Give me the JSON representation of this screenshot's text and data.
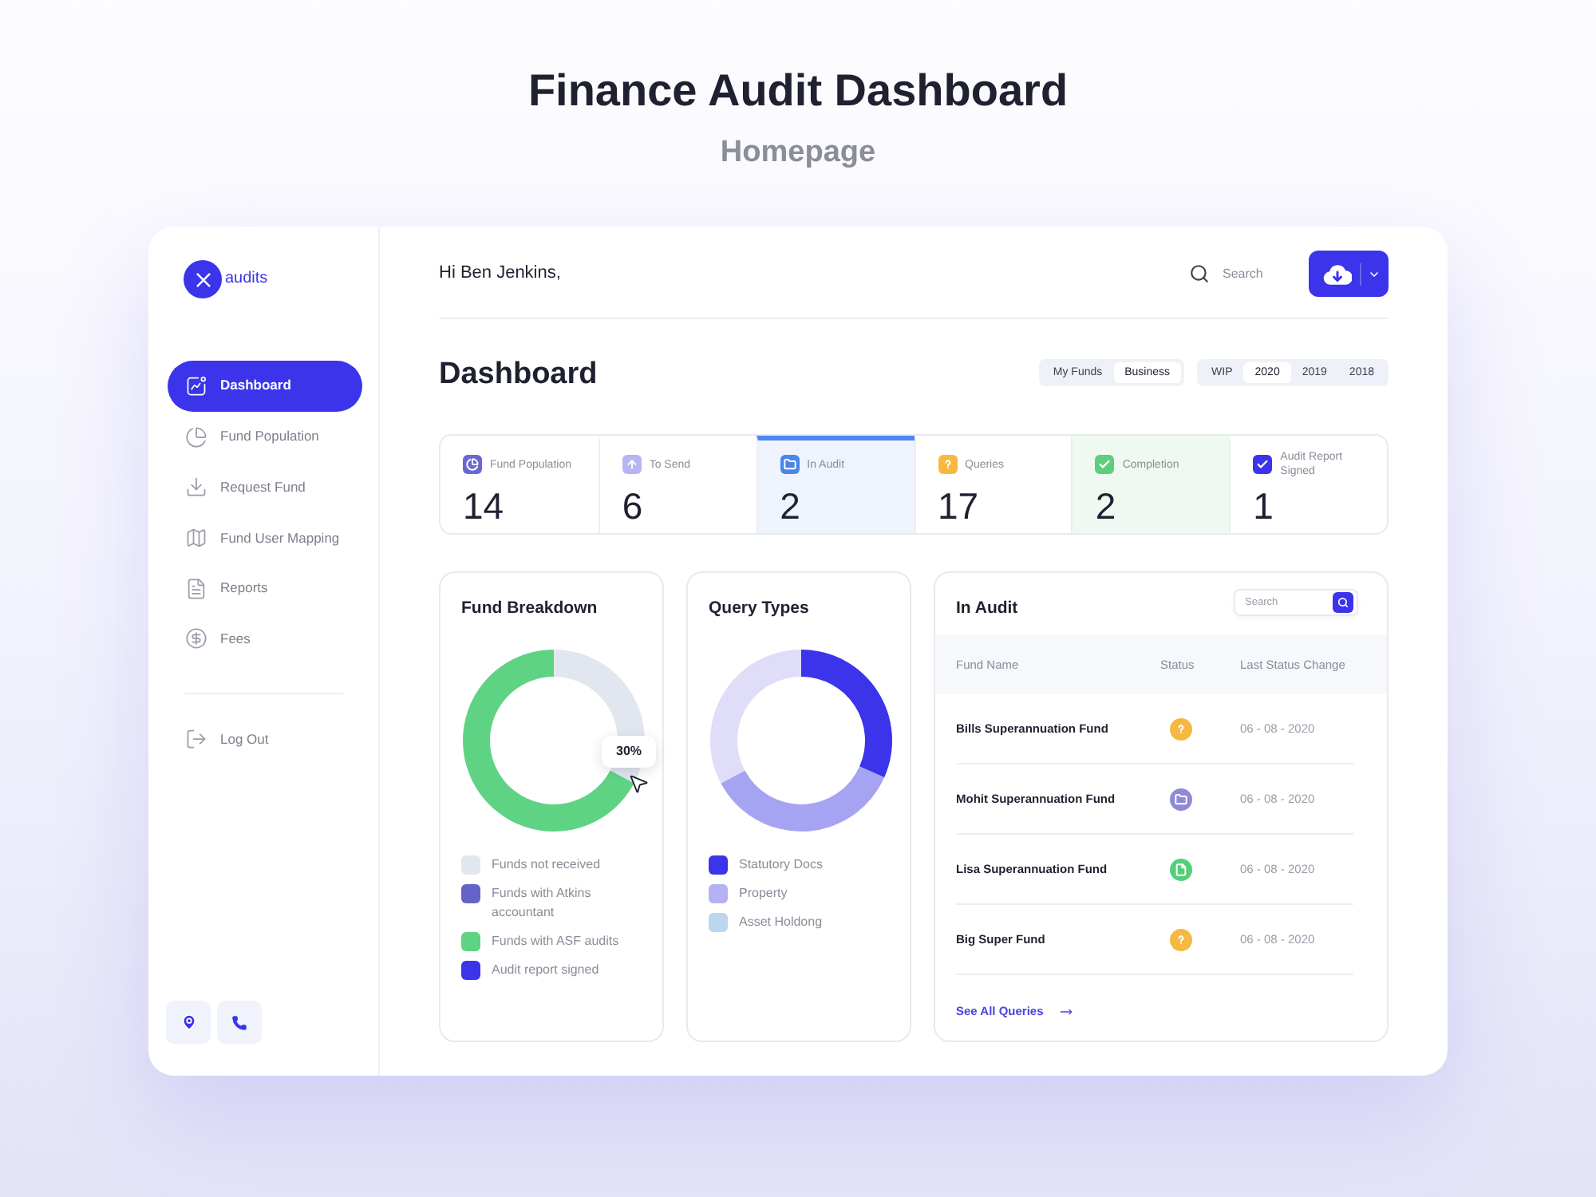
{
  "page": {
    "title": "Finance Audit Dashboard",
    "subtitle": "Homepage"
  },
  "sidebar": {
    "logo_text": "audits",
    "items": [
      {
        "label": "Dashboard",
        "selected": true
      },
      {
        "label": "Fund Population",
        "selected": false
      },
      {
        "label": "Request Fund",
        "selected": false
      },
      {
        "label": "Fund User Mapping",
        "selected": false
      },
      {
        "label": "Reports",
        "selected": false
      },
      {
        "label": "Fees",
        "selected": false
      }
    ],
    "logout": {
      "label": "Log Out"
    }
  },
  "header": {
    "greeting": "Hi Ben Jenkins,",
    "search": {
      "placeholder": "Search"
    }
  },
  "dashboard": {
    "title": "Dashboard",
    "tab_groups": [
      [
        {
          "label": "My Funds",
          "selected": false
        },
        {
          "label": "Business",
          "selected": true
        }
      ],
      [
        {
          "label": "WIP",
          "selected": false
        },
        {
          "label": "2020",
          "selected": true
        },
        {
          "label": "2019",
          "selected": false
        },
        {
          "label": "2018",
          "selected": false
        }
      ]
    ]
  },
  "stats": [
    {
      "label": "Fund Population",
      "value": "14",
      "color": "#6868d0",
      "selected": false
    },
    {
      "label": "To Send",
      "value": "6",
      "color": "#b7b5f2",
      "selected": false
    },
    {
      "label": "In Audit",
      "value": "2",
      "color": "#4a86e8",
      "selected": true,
      "highlight": {
        "color": "#eef3fd"
      }
    },
    {
      "label": "Queries",
      "value": "17",
      "color": "#f5b942",
      "selected": false
    },
    {
      "label": "Completion",
      "value": "2",
      "color": "#5ccf7d",
      "selected": false,
      "highlight": {
        "color": "#eff9f1"
      }
    },
    {
      "label": "Audit Report Signed",
      "value": "1",
      "color": "#3b34ea",
      "selected": false
    }
  ],
  "fund_breakdown": {
    "title": "Fund Breakdown",
    "tooltip": "30%",
    "legend": [
      {
        "label": "Funds not received",
        "color": "#e2e6ee"
      },
      {
        "label": "Funds with Atkins accountant",
        "color": "#6464c8"
      },
      {
        "label": "Funds with ASF audits",
        "color": "#5fd384"
      },
      {
        "label": "Audit report signed",
        "color": "#3b34ea"
      }
    ]
  },
  "query_types": {
    "title": "Query Types",
    "legend": [
      {
        "label": "Statutory Docs",
        "color": "#3b34ea"
      },
      {
        "label": "Property",
        "color": "#b4b2f2"
      },
      {
        "label": "Asset Holdong",
        "color": "#bcd6ee"
      }
    ]
  },
  "in_audit": {
    "title": "In Audit",
    "search": {
      "placeholder": "Search"
    },
    "columns": [
      "Fund Name",
      "Status",
      "Last Status Change"
    ],
    "rows": [
      {
        "fund_name": "Bills Superannuation Fund",
        "status": {
          "kind": "query",
          "color": "#f5b942"
        },
        "last_status_change": "06 - 08 - 2020"
      },
      {
        "fund_name": "Mohit Superannuation Fund",
        "status": {
          "kind": "folder",
          "color": "#8f8ad8"
        },
        "last_status_change": "06 - 08 - 2020"
      },
      {
        "fund_name": "Lisa Superannuation Fund",
        "status": {
          "kind": "document",
          "color": "#55cf7a"
        },
        "last_status_change": "06 - 08 - 2020"
      },
      {
        "fund_name": "Big Super Fund",
        "status": {
          "kind": "query",
          "color": "#f5b942"
        },
        "last_status_change": "06 - 08 - 2020"
      }
    ],
    "link": "See All Queries"
  }
}
